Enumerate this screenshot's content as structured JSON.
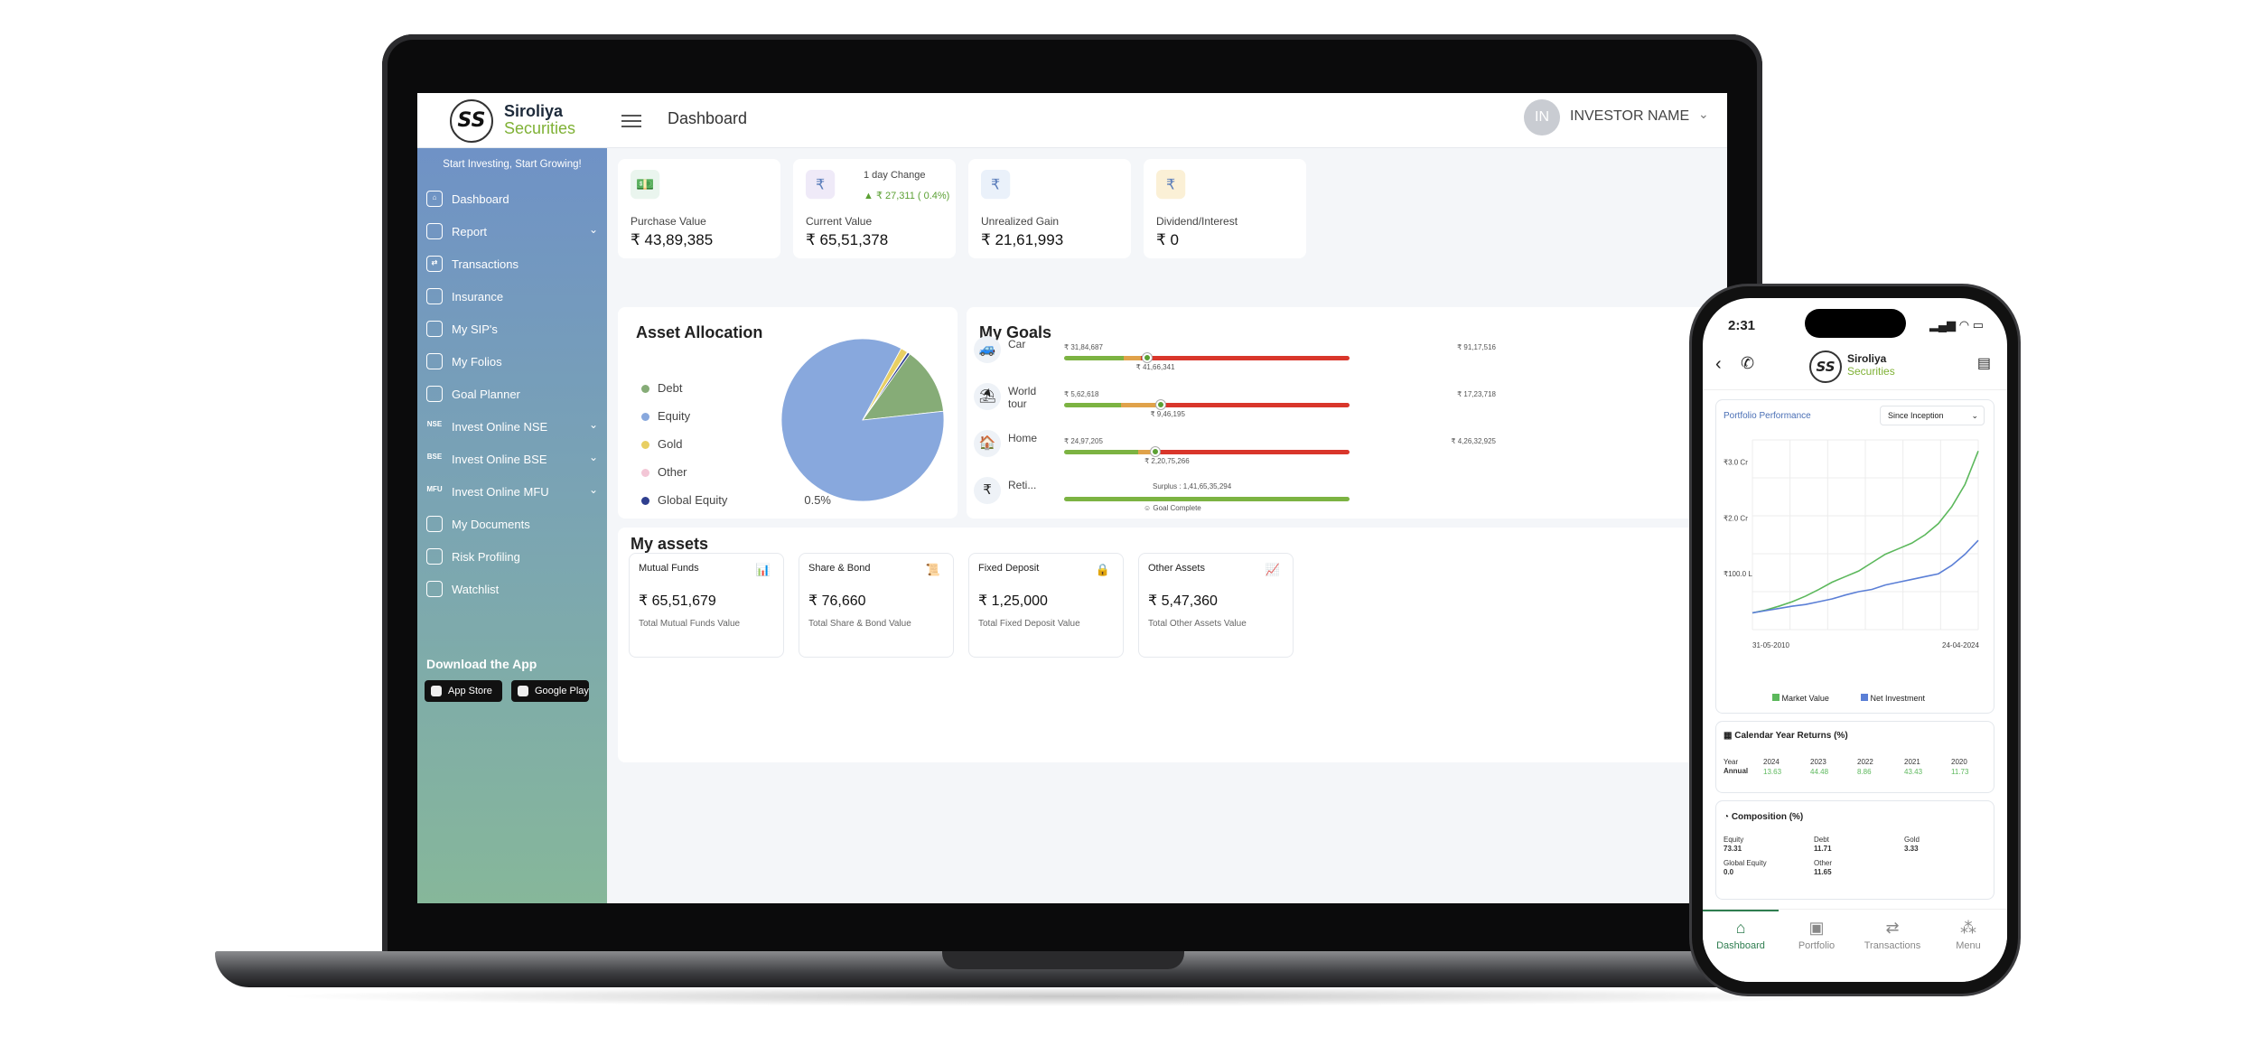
{
  "app": {
    "logo_mark": "SS",
    "logo_line1": "Siroliya",
    "logo_line2": "Securities",
    "page_title": "Dashboard",
    "user_initials": "IN",
    "user_name": "INVESTOR NAME"
  },
  "sidebar": {
    "tagline": "Start Investing, Start Growing!",
    "items": [
      {
        "label": "Dashboard",
        "icon": "home-icon",
        "glyph": "⌂",
        "has_sub": false
      },
      {
        "label": "Report",
        "icon": "report-icon",
        "glyph": "",
        "has_sub": true
      },
      {
        "label": "Transactions",
        "icon": "transfer-icon",
        "glyph": "⇄",
        "has_sub": false
      },
      {
        "label": "Insurance",
        "icon": "document-icon",
        "glyph": "",
        "has_sub": false
      },
      {
        "label": "My SIP's",
        "icon": "sip-icon",
        "glyph": "",
        "has_sub": false
      },
      {
        "label": "My Folios",
        "icon": "folio-icon",
        "glyph": "",
        "has_sub": false
      },
      {
        "label": "Goal Planner",
        "icon": "target-icon",
        "glyph": "",
        "has_sub": false
      },
      {
        "label": "Invest Online NSE",
        "icon": "nse-icon",
        "glyph": "NSE",
        "has_sub": true
      },
      {
        "label": "Invest Online BSE",
        "icon": "bse-icon",
        "glyph": "BSE",
        "has_sub": true
      },
      {
        "label": "Invest Online MFU",
        "icon": "mfu-icon",
        "glyph": "MFU",
        "has_sub": true
      },
      {
        "label": "My Documents",
        "icon": "documents-icon",
        "glyph": "",
        "has_sub": false
      },
      {
        "label": "Risk Profiling",
        "icon": "gauge-icon",
        "glyph": "",
        "has_sub": false
      },
      {
        "label": "Watchlist",
        "icon": "list-icon",
        "glyph": "",
        "has_sub": false
      }
    ],
    "download_title": "Download the App",
    "app_store": "App Store",
    "google_play": "Google Play"
  },
  "kpis": [
    {
      "label": "Purchase Value",
      "value": "₹ 43,89,385",
      "icon": "money-stack-icon",
      "glyph": "💵",
      "bg": "#eaf5ee"
    },
    {
      "label": "Current Value",
      "value": "₹ 65,51,378",
      "icon": "rupee-coins-icon",
      "glyph": "₹",
      "bg": "#efeaf8"
    },
    {
      "label": "Unrealized Gain",
      "value": "₹ 21,61,993",
      "icon": "hand-coin-icon",
      "glyph": "₹",
      "bg": "#eaf1fa"
    },
    {
      "label": "Dividend/Interest",
      "value": "₹ 0",
      "icon": "money-bag-icon",
      "glyph": "₹",
      "bg": "#fbf0d6"
    }
  ],
  "day_change": {
    "label": "1 day Change",
    "value": "₹ 27,311 ( 0.4%)"
  },
  "asset_allocation": {
    "title": "Asset Allocation",
    "items": [
      {
        "name": "Debt",
        "pct": "13.4%",
        "value": 13.4,
        "color": "#86ac77"
      },
      {
        "name": "Equity",
        "pct": "84.6%",
        "value": 84.6,
        "color": "#88a8dd"
      },
      {
        "name": "Gold",
        "pct": "1.4%",
        "value": 1.4,
        "color": "#e8cf63"
      },
      {
        "name": "Other",
        "pct": "0.1%",
        "value": 0.1,
        "color": "#f3c6d6"
      },
      {
        "name": "Global Equity",
        "pct": "0.5%",
        "value": 0.5,
        "color": "#2f3f8f"
      }
    ]
  },
  "goals": {
    "title": "My Goals",
    "items": [
      {
        "name": "Car",
        "icon": "car-icon",
        "glyph": "🚙",
        "left": "₹ 31,84,687",
        "right": "₹ 91,17,516",
        "mid": "₹ 41,66,341",
        "progress": 0.29,
        "green": 0.21,
        "orange": 0.06
      },
      {
        "name": "World tour",
        "icon": "beach-umbrella-icon",
        "glyph": "⛱",
        "left": "₹ 5,62,618",
        "right": "₹ 17,23,718",
        "mid": "₹ 9,46,195",
        "progress": 0.34,
        "green": 0.2,
        "orange": 0.14
      },
      {
        "name": "Home",
        "icon": "house-icon",
        "glyph": "🏠",
        "left": "₹ 24,97,205",
        "right": "₹ 4,26,32,925",
        "mid": "₹ 2,20,75,266",
        "progress": 0.32,
        "green": 0.26,
        "orange": 0.06
      },
      {
        "name": "Reti...",
        "icon": "retirement-icon",
        "glyph": "₹",
        "surplus": "Surplus :   1,41,65,35,294",
        "complete": "Goal Complete",
        "progress": 1.0
      }
    ]
  },
  "my_assets": {
    "title": "My assets",
    "items": [
      {
        "name": "Mutual Funds",
        "value": "₹ 65,51,679",
        "desc": "Total Mutual Funds Value",
        "icon": "growth-chart-icon",
        "glyph": "📊",
        "color": "#8cc59a"
      },
      {
        "name": "Share & Bond",
        "value": "₹ 76,660",
        "desc": "Total Share & Bond Value",
        "icon": "certificate-icon",
        "glyph": "📜",
        "color": "#8d6bd8"
      },
      {
        "name": "Fixed Deposit",
        "value": "₹ 1,25,000",
        "desc": "Total Fixed Deposit Value",
        "icon": "safe-icon",
        "glyph": "🔒",
        "color": "#5b8fd1"
      },
      {
        "name": "Other Assets",
        "value": "₹ 5,47,360",
        "desc": "Total Other Assets Value",
        "icon": "chart-up-icon",
        "glyph": "📈",
        "color": "#5b8fd1"
      }
    ]
  },
  "phone": {
    "time": "2:31",
    "portfolio_title": "Portfolio Performance",
    "range": "Since Inception",
    "y_ticks": [
      "₹3.0 Cr",
      "₹2.0 Cr",
      "₹100.0 L"
    ],
    "x_start": "31-05-2010",
    "x_end": "24-04-2024",
    "legend_market": "Market Value",
    "legend_invest": "Net Investment",
    "chart_data": {
      "type": "line",
      "x": [
        "31-05-2010",
        "24-04-2024"
      ],
      "series": [
        {
          "name": "Market Value",
          "color": "#5cb85c",
          "values": [
            0.3,
            0.35,
            0.42,
            0.5,
            0.6,
            0.72,
            0.85,
            0.95,
            1.05,
            1.2,
            1.35,
            1.45,
            1.55,
            1.7,
            1.9,
            2.2,
            2.6,
            3.2
          ]
        },
        {
          "name": "Net Investment",
          "color": "#5b7fd6",
          "values": [
            0.3,
            0.34,
            0.38,
            0.42,
            0.45,
            0.5,
            0.55,
            0.62,
            0.68,
            0.72,
            0.8,
            0.85,
            0.9,
            0.95,
            1.0,
            1.15,
            1.35,
            1.6
          ]
        }
      ]
    },
    "cal_title": "Calendar Year Returns (%)",
    "cal_year_label": "Year",
    "cal_annual_label": "Annual",
    "cal_years": [
      "2024",
      "2023",
      "2022",
      "2021",
      "2020"
    ],
    "cal_returns": [
      "13.63",
      "44.48",
      "8.86",
      "43.43",
      "11.73"
    ],
    "comp_title": "Composition (%)",
    "composition": [
      {
        "name": "Equity",
        "value": "73.31"
      },
      {
        "name": "Debt",
        "value": "11.71"
      },
      {
        "name": "Gold",
        "value": "3.33"
      },
      {
        "name": "Global Equity",
        "value": "0.0"
      },
      {
        "name": "Other",
        "value": "11.65"
      }
    ],
    "tabs": [
      {
        "label": "Dashboard",
        "glyph": "⌂",
        "active": true
      },
      {
        "label": "Portfolio",
        "glyph": "▣",
        "active": false
      },
      {
        "label": "Transactions",
        "glyph": "⇄",
        "active": false
      },
      {
        "label": "Menu",
        "glyph": "⁂",
        "active": false
      }
    ]
  }
}
